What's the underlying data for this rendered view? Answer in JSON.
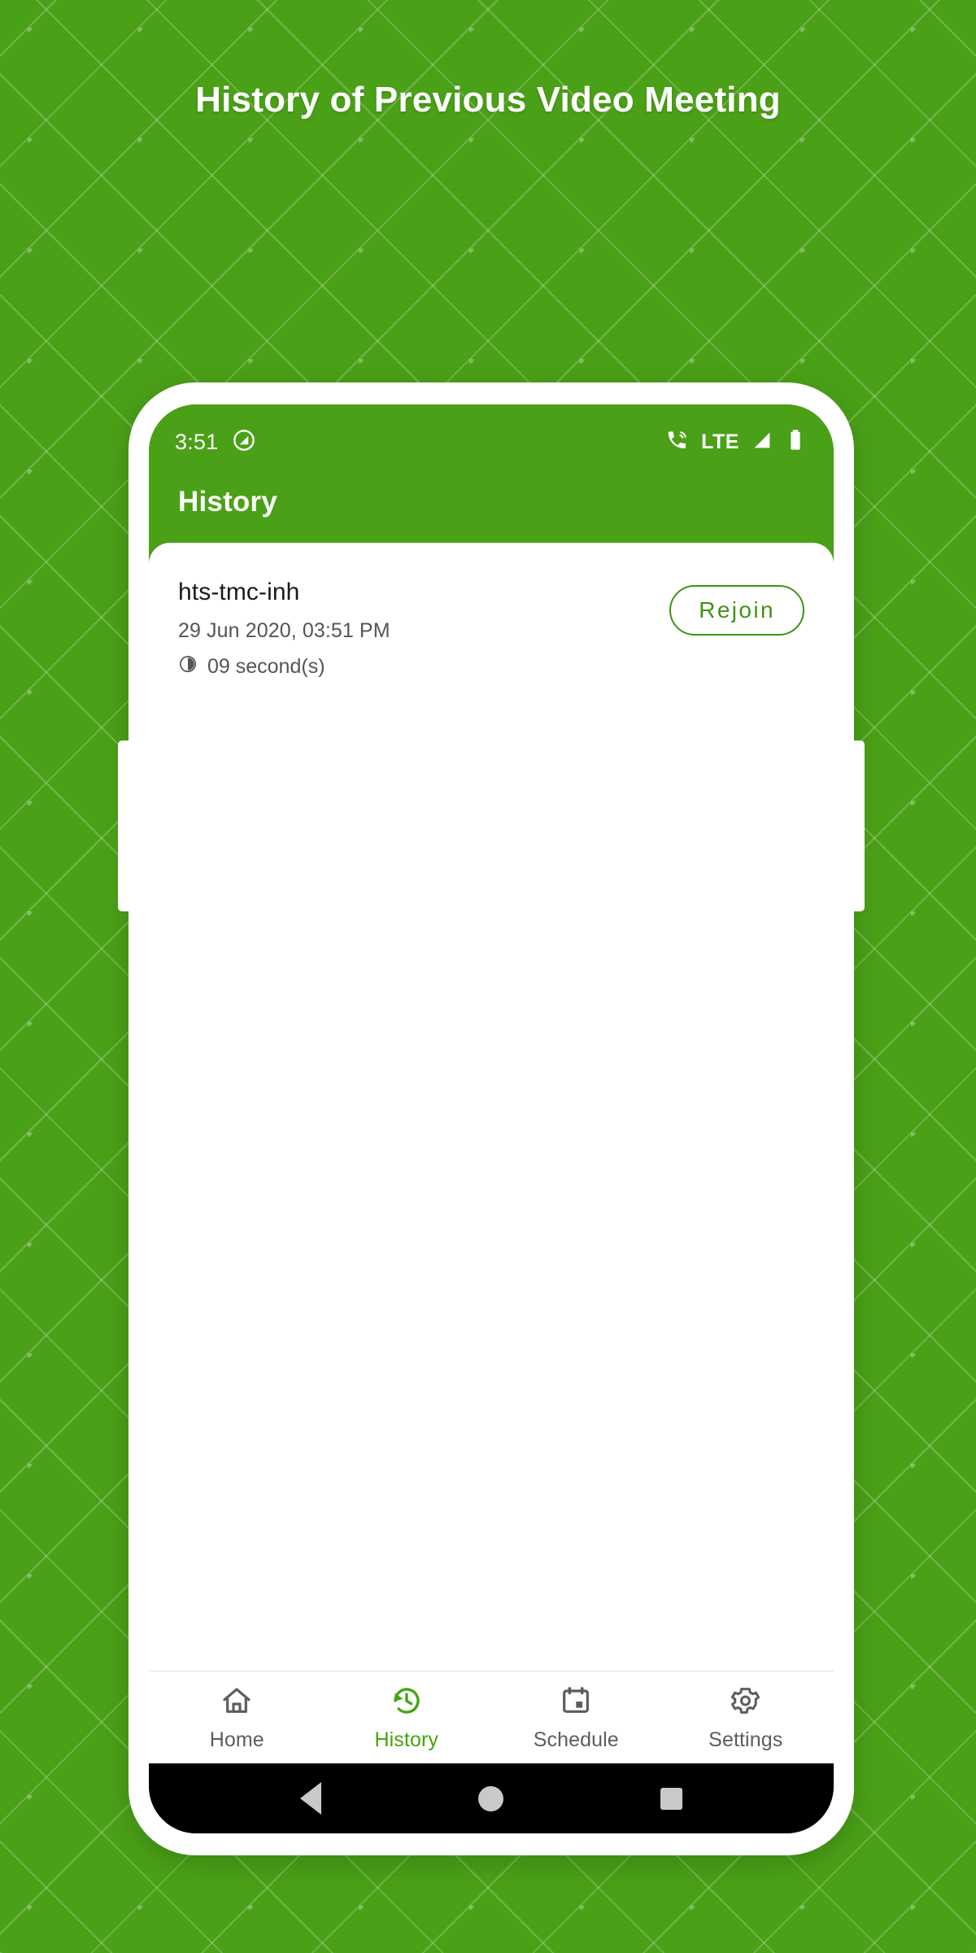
{
  "theme": {
    "brand_green": "#4aa017",
    "accent_green": "#3f9412",
    "nav_active_green": "#43a50f",
    "white": "#ffffff",
    "black": "#000000"
  },
  "poster": {
    "heading": "History of Previous Video Meeting"
  },
  "phone": {
    "status_bar": {
      "time": "3:51",
      "left_icons": [
        "do-not-disturb-icon"
      ],
      "network_label": "LTE",
      "right_icons": [
        "call-signal-icon",
        "cellular-signal-icon",
        "battery-icon"
      ]
    },
    "app_bar": {
      "title": "History"
    },
    "history": {
      "items": [
        {
          "name": "hts-tmc-inh",
          "date": "29 Jun 2020, 03:51 PM",
          "duration": "09 second(s)",
          "duration_icon": "timer-icon",
          "action_label": "Rejoin"
        }
      ]
    },
    "bottom_nav": {
      "items": [
        {
          "label": "Home",
          "icon": "home-icon",
          "active": false
        },
        {
          "label": "History",
          "icon": "history-icon",
          "active": true
        },
        {
          "label": "Schedule",
          "icon": "calendar-icon",
          "active": false
        },
        {
          "label": "Settings",
          "icon": "gear-icon",
          "active": false
        }
      ]
    },
    "android_nav": {
      "buttons": [
        "back-button",
        "home-button",
        "recents-button"
      ]
    }
  }
}
